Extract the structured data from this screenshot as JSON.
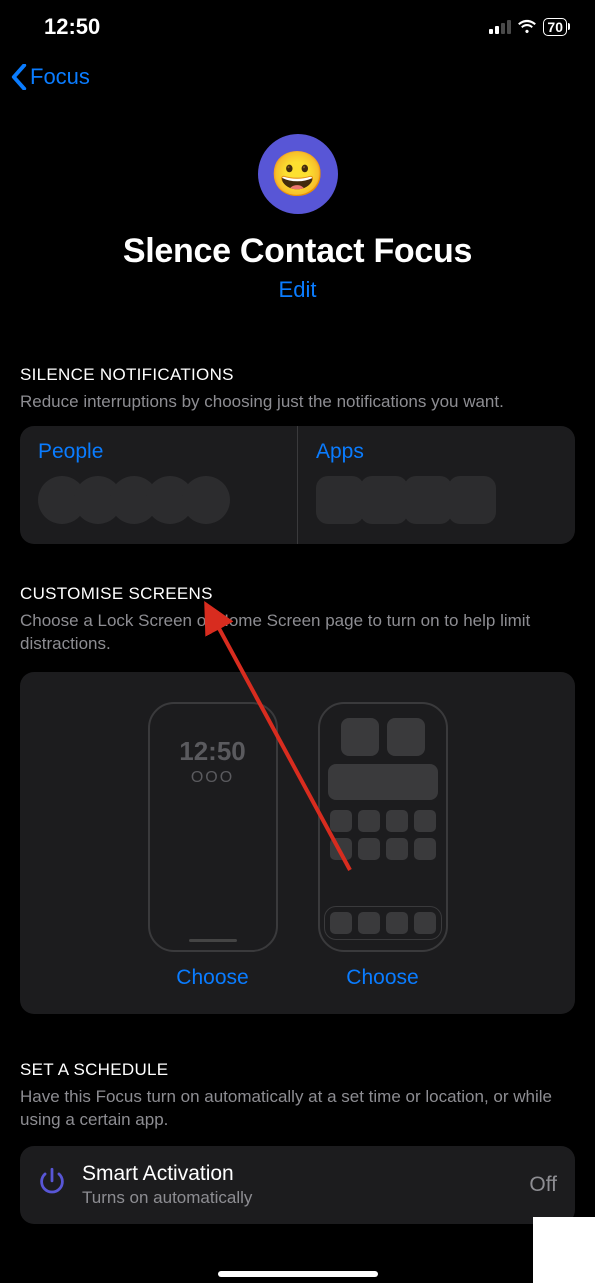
{
  "status": {
    "time": "12:50",
    "battery": "70"
  },
  "nav": {
    "back_label": "Focus"
  },
  "header": {
    "emoji": "😀",
    "title": "Slence Contact Focus",
    "edit_label": "Edit"
  },
  "silence": {
    "heading": "SILENCE NOTIFICATIONS",
    "sub": "Reduce interruptions by choosing just the notifications you want.",
    "people_label": "People",
    "apps_label": "Apps"
  },
  "customise": {
    "heading": "CUSTOMISE SCREENS",
    "sub": "Choose a Lock Screen or Home Screen page to turn on to help limit distractions.",
    "lock_time": "12:50",
    "lock_dots": "OOO",
    "choose_label": "Choose"
  },
  "schedule": {
    "heading": "SET A SCHEDULE",
    "sub": "Have this Focus turn on automatically at a set time or location, or while using a certain app.",
    "item_title": "Smart Activation",
    "item_sub": "Turns on automatically",
    "state": "Off"
  }
}
